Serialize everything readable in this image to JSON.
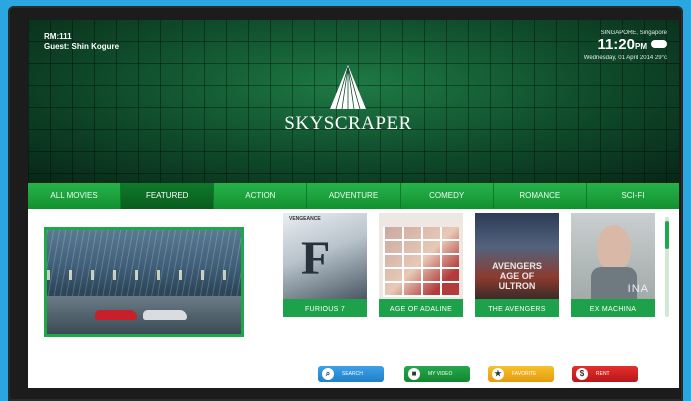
{
  "header": {
    "room": "RM:111",
    "guest": "Guest: Shin Kogure",
    "location": "SINGAPORE, Singapore",
    "time": "11:20",
    "ampm": "PM",
    "date": "Wednesday, 01 April 2014 29°c",
    "weather_icon": "cloud-icon",
    "brand": "SKYSCRAPER"
  },
  "nav": {
    "tabs": [
      {
        "label": "ALL MOVIES"
      },
      {
        "label": "FEATURED"
      },
      {
        "label": "ACTION"
      },
      {
        "label": "ADVENTURE"
      },
      {
        "label": "COMEDY"
      },
      {
        "label": "ROMANCE"
      },
      {
        "label": "SCI-FI"
      }
    ],
    "active_index": 1
  },
  "posters": [
    {
      "title": "FURIOUS 7",
      "art_text": "F",
      "tagline": "VENGEANCE"
    },
    {
      "title": "AGE OF ADALINE"
    },
    {
      "title": "THE AVENGERS",
      "art_text": "AVENGERS AGE OF ULTRON"
    },
    {
      "title": "EX MACHINA",
      "art_text": "INA"
    }
  ],
  "actions": [
    {
      "label": "SEARCH",
      "icon": "search-icon",
      "glyph": "⌕",
      "color": "#2a8fd8"
    },
    {
      "label": "MY VIDEO",
      "icon": "video-icon",
      "glyph": "■",
      "color": "#1a9a40"
    },
    {
      "label": "FAVORITE",
      "icon": "star-icon",
      "glyph": "★",
      "color": "#f0ac1a"
    },
    {
      "label": "RENT",
      "icon": "rent-icon",
      "glyph": "$",
      "color": "#d2221f"
    }
  ]
}
